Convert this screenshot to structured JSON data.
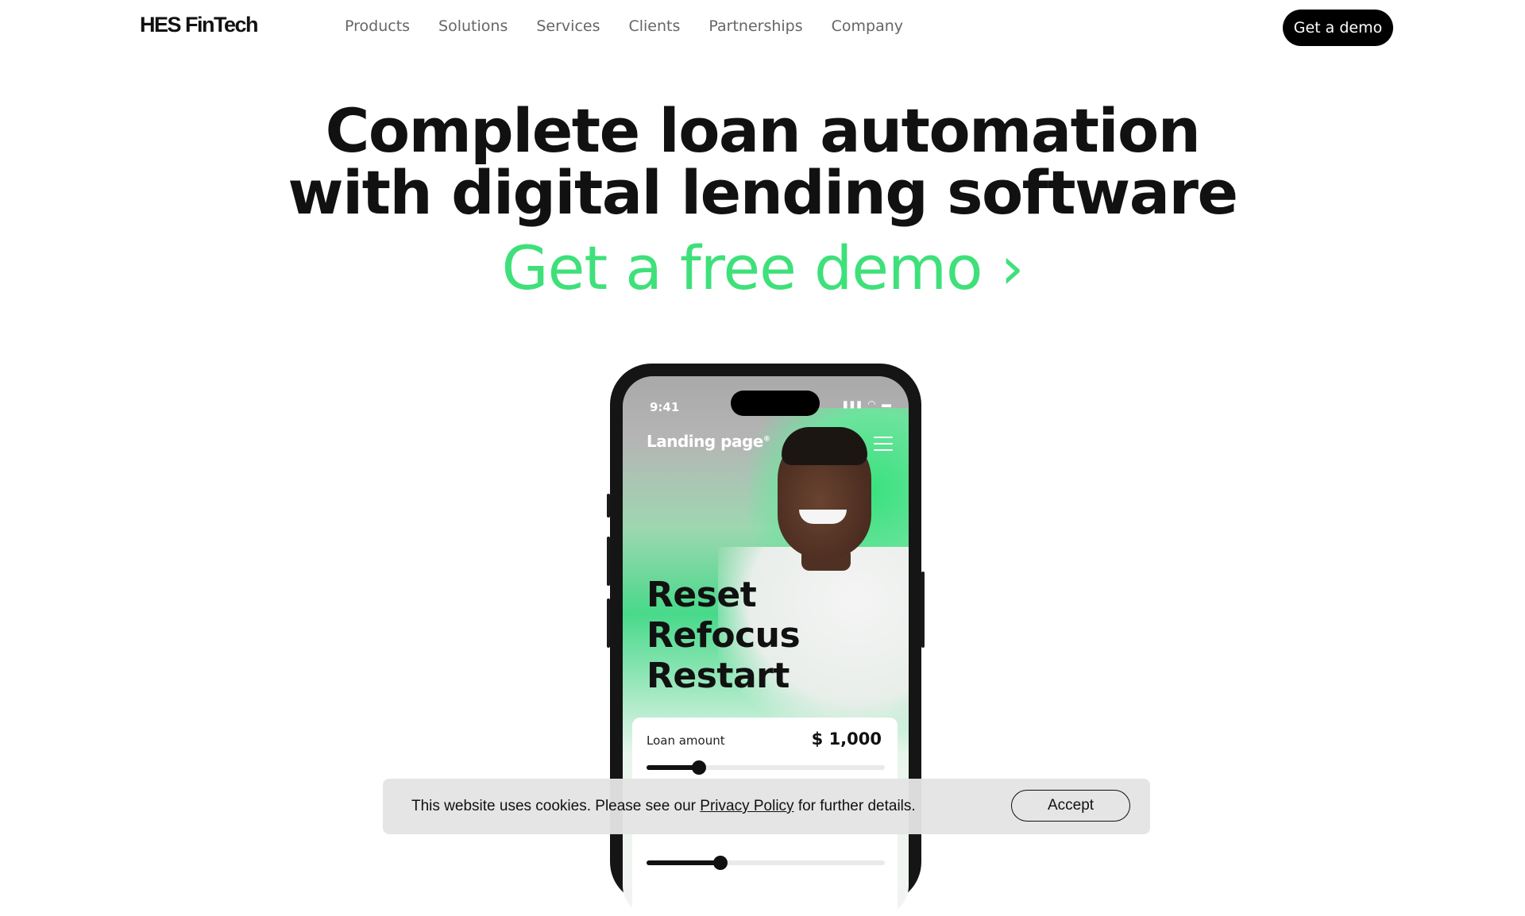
{
  "header": {
    "logo": "HES FinTech",
    "nav": [
      "Products",
      "Solutions",
      "Services",
      "Clients",
      "Partnerships",
      "Company"
    ],
    "cta_label": "Get a demo"
  },
  "hero": {
    "title_line1": "Complete loan automation",
    "title_line2": "with digital lending software",
    "free_demo": "Get a free demo",
    "chevron": "›"
  },
  "phone": {
    "time": "9:41",
    "status_icons": "signal-icon wifi-icon battery-icon",
    "brand": "Landing page",
    "brand_mark": "®",
    "headline": [
      "Reset",
      "Refocus",
      "Restart"
    ],
    "loan_label": "Loan amount",
    "loan_value": "$ 1,000",
    "loan_slider_level": 0.22,
    "second_slider_level": 0.31
  },
  "cookie": {
    "text_before": "This website uses cookies. Please see our ",
    "link": "Privacy Policy",
    "text_after": " for further details.",
    "accept_label": "Accept"
  },
  "colors": {
    "accent_green": "#3fe07a",
    "cta_bg": "#000000"
  }
}
